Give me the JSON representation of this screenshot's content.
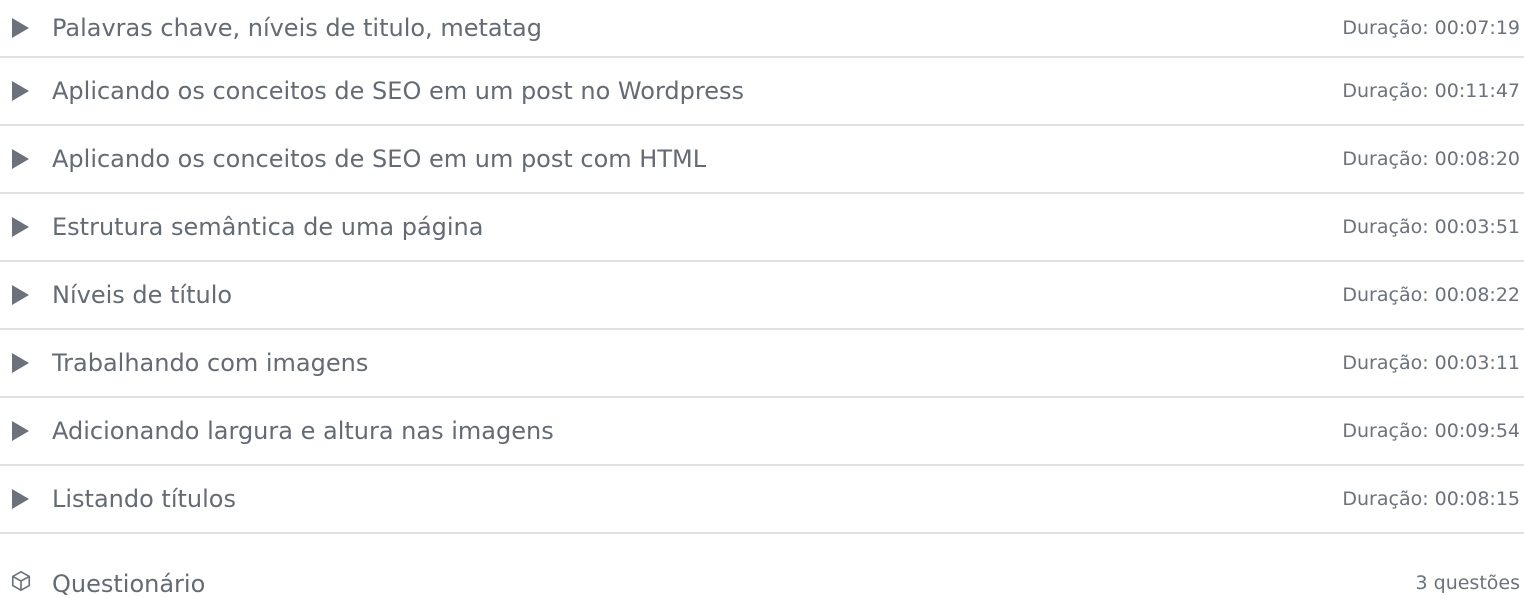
{
  "lessons": [
    {
      "title": "Palavras chave, níveis de titulo, metatag",
      "duration": "Duração: 00:07:19"
    },
    {
      "title": "Aplicando os conceitos de SEO em um post no Wordpress",
      "duration": "Duração: 00:11:47"
    },
    {
      "title": "Aplicando os conceitos de SEO em um post com HTML",
      "duration": "Duração: 00:08:20"
    },
    {
      "title": "Estrutura semântica de uma página",
      "duration": "Duração: 00:03:51"
    },
    {
      "title": "Níveis de título",
      "duration": "Duração: 00:08:22"
    },
    {
      "title": "Trabalhando com imagens",
      "duration": "Duração: 00:03:11"
    },
    {
      "title": "Adicionando largura e altura nas imagens",
      "duration": "Duração: 00:09:54"
    },
    {
      "title": "Listando títulos",
      "duration": "Duração: 00:08:15"
    }
  ],
  "quiz": {
    "title": "Questionário",
    "count": "3 questões",
    "icon": "cube-icon"
  },
  "colors": {
    "text": "#646b74",
    "divider": "#dfe1e4",
    "icon": "#6b727b"
  }
}
